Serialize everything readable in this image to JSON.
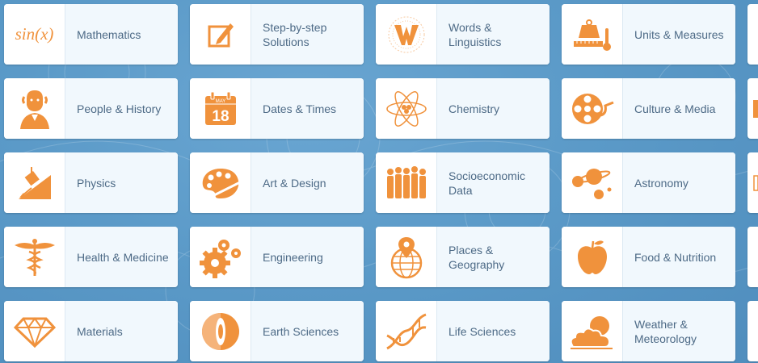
{
  "accent_color": "#f0923c",
  "tiles": [
    {
      "label": "Mathematics",
      "icon": "sin-x-icon",
      "glyph": "sin(x)"
    },
    {
      "label": "Step-by-step Solutions",
      "icon": "pencil-edit-icon"
    },
    {
      "label": "Words & Linguistics",
      "icon": "letter-w-icon"
    },
    {
      "label": "Units & Measures",
      "icon": "scale-ruler-thermometer-icon"
    },
    {
      "label": "People & History",
      "icon": "historical-portrait-icon"
    },
    {
      "label": "Dates & Times",
      "icon": "calendar-icon",
      "cal_month": "MAY",
      "cal_day": "18"
    },
    {
      "label": "Chemistry",
      "icon": "atom-icon"
    },
    {
      "label": "Culture & Media",
      "icon": "film-reel-icon"
    },
    {
      "label": "Physics",
      "icon": "inclined-plane-icon"
    },
    {
      "label": "Art & Design",
      "icon": "paint-palette-icon"
    },
    {
      "label": "Socioeconomic Data",
      "icon": "crowd-icon"
    },
    {
      "label": "Astronomy",
      "icon": "planets-icon"
    },
    {
      "label": "Health & Medicine",
      "icon": "caduceus-icon"
    },
    {
      "label": "Engineering",
      "icon": "gears-icon"
    },
    {
      "label": "Places & Geography",
      "icon": "globe-pin-icon"
    },
    {
      "label": "Food & Nutrition",
      "icon": "apple-icon"
    },
    {
      "label": "Materials",
      "icon": "diamond-icon"
    },
    {
      "label": "Earth Sciences",
      "icon": "earth-layers-icon"
    },
    {
      "label": "Life Sciences",
      "icon": "dna-icon"
    },
    {
      "label": "Weather & Meteorology",
      "icon": "sun-cloud-icon"
    }
  ]
}
